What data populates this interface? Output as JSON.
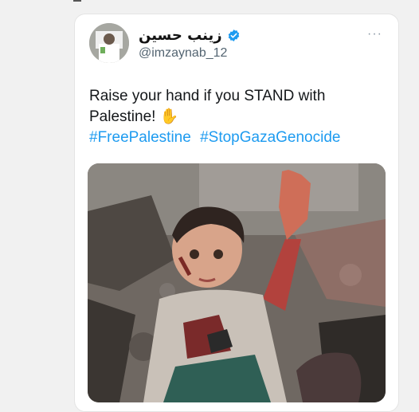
{
  "tweet": {
    "display_name": "زينب حسين",
    "handle": "@imzaynab_12",
    "more_label": "···",
    "text": "Raise your hand if you STAND with Palestine! ✋",
    "hashtags": [
      "#FreePalestine",
      "#StopGazaGenocide"
    ]
  },
  "icons": {
    "verified": "verified-badge-icon",
    "more": "more-options-icon"
  },
  "colors": {
    "link": "#1d9bf0",
    "verified": "#1d9bf0",
    "handle": "#536471"
  }
}
